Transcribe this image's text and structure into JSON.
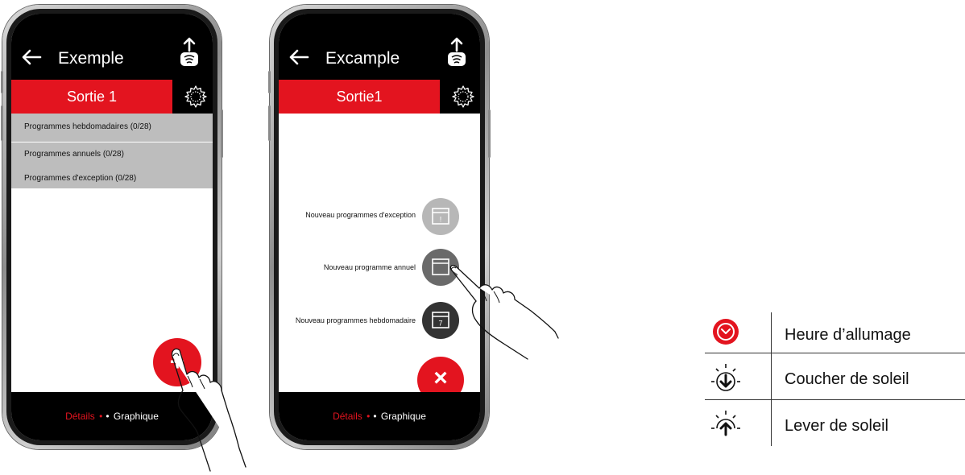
{
  "phone1": {
    "title": "Exemple",
    "output_label": "Sortie 1",
    "list": [
      "Programmes hebdomadaires (0/28)",
      "Programmes annuels (0/28)",
      "Programmes d'exception (0/28)"
    ],
    "fab_symbol": "+",
    "tab_details": "Détails",
    "tab_graph": "Graphique",
    "sep_red": "•",
    "sep_white": "•"
  },
  "phone2": {
    "title": "Excample",
    "output_label": "Sortie1",
    "menu": [
      {
        "label": "Nouveau programmes d'exception",
        "icon": "calendar-exception-icon",
        "glyph": "!",
        "color": "#b7b7b7"
      },
      {
        "label": "Nouveau programme annuel",
        "icon": "calendar-annual-icon",
        "glyph": "",
        "color": "#6a6a6a"
      },
      {
        "label": "Nouveau programmes hebdomadaire",
        "icon": "calendar-weekly-icon",
        "glyph": "7",
        "color": "#333333"
      }
    ],
    "close_symbol": "×",
    "tab_details": "Détails",
    "tab_graph": "Graphique",
    "sep_red": "•",
    "sep_white": "•"
  },
  "legend": [
    {
      "icon": "clock-icon",
      "label": "Heure d’allumage"
    },
    {
      "icon": "sunset-icon",
      "label": "Coucher de soleil"
    },
    {
      "icon": "sunrise-icon",
      "label": "Lever de soleil"
    }
  ],
  "colors": {
    "accent": "#e3141f",
    "bar": "#000000",
    "list_bg": "#bdbdbd"
  }
}
